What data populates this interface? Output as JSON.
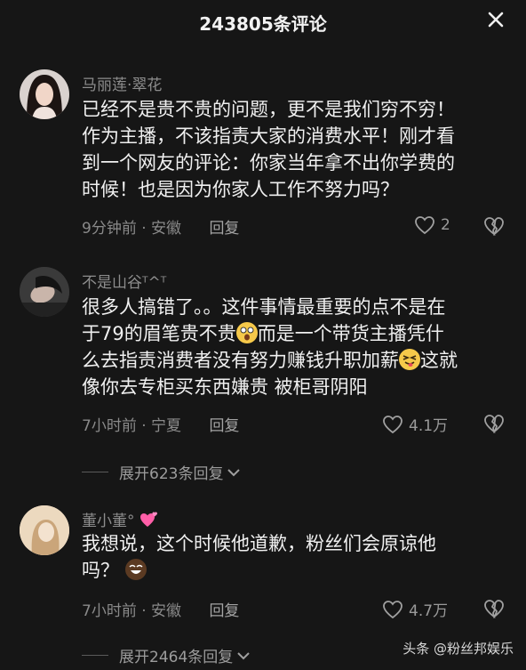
{
  "header": {
    "title": "243805条评论",
    "close_icon": "close-icon"
  },
  "comments": [
    {
      "username": "马丽莲·翠花",
      "lines": [
        "已经不是贵不贵的问题，更不是我们穷不穷！",
        "作为主播，不该指责大家的消费水平！刚才看",
        "到一个网友的评论：你家当年拿不出你学费的",
        "时候！也是因为你家人工作不努力吗？"
      ],
      "time_location": "9分钟前 · 安徽",
      "reply_label": "回复",
      "likes": "2"
    },
    {
      "username": "不是山谷ᵀ^ᵀ",
      "lines": [
        "很多人搞错了。。这件事情最重要的点不是在",
        "于79的眉笔贵不贵",
        "而是一个带货主播凭什",
        "么去指责消费者没有努力赚钱升职加薪",
        "这就",
        "像你去专柜买东西嫌贵 被柜哥阴阳"
      ],
      "time_location": "7小时前 · 宁夏",
      "reply_label": "回复",
      "likes": "4.1万",
      "expand_label": "展开623条回复"
    },
    {
      "username": "董小董°",
      "lines": [
        "我想说，这个时候他道歉，粉丝们会原谅他",
        "吗？"
      ],
      "time_location": "7小时前 · 安徽",
      "reply_label": "回复",
      "likes": "4.7万",
      "expand_label": "展开2464条回复"
    }
  ],
  "watermark": "头条 @粉丝邦娱乐",
  "colors": {
    "background": "#161616",
    "text": "#f0f0f0",
    "secondary": "#8a8a8a"
  }
}
